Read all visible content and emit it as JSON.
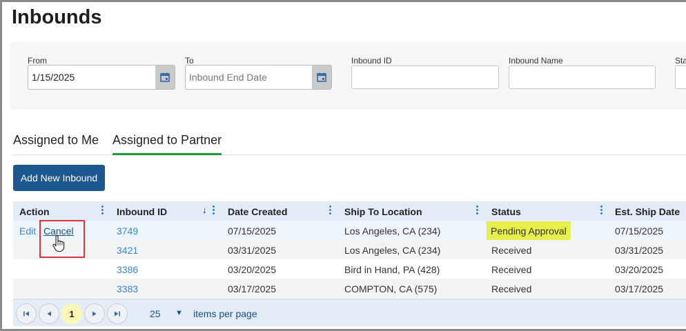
{
  "page": {
    "title": "Inbounds"
  },
  "filters": {
    "from": {
      "label": "From",
      "value": "1/15/2025"
    },
    "to": {
      "label": "To",
      "value": "",
      "placeholder": "Inbound End Date"
    },
    "inbound_id": {
      "label": "Inbound ID",
      "value": ""
    },
    "inbound_name": {
      "label": "Inbound Name",
      "value": ""
    },
    "status": {
      "label": "Sta"
    },
    "calendar_icon": "calendar-icon"
  },
  "tabs": [
    {
      "label": "Assigned to Me",
      "active": false
    },
    {
      "label": "Assigned to Partner",
      "active": true
    }
  ],
  "toolbar": {
    "add_label": "Add New Inbound"
  },
  "grid": {
    "columns": [
      "Action",
      "Inbound ID",
      "Date Created",
      "Ship To Location",
      "Status",
      "Est. Ship Date"
    ],
    "sort_indicator": "↓",
    "action_labels": {
      "edit": "Edit",
      "cancel": "Cancel"
    },
    "rows": [
      {
        "inbound_id": "3749",
        "date_created": "07/15/2025",
        "ship_to": "Los Angeles, CA (234)",
        "status": "Pending Approval",
        "est_ship": "07/15/2025"
      },
      {
        "inbound_id": "3421",
        "date_created": "03/31/2025",
        "ship_to": "Los Angeles, CA (234)",
        "status": "Received",
        "est_ship": "03/31/2025"
      },
      {
        "inbound_id": "3386",
        "date_created": "03/20/2025",
        "ship_to": "Bird in Hand, PA (428)",
        "status": "Received",
        "est_ship": "03/20/2025"
      },
      {
        "inbound_id": "3383",
        "date_created": "03/17/2025",
        "ship_to": "COMPTON, CA (575)",
        "status": "Received",
        "est_ship": "03/17/2025"
      }
    ]
  },
  "pager": {
    "current_page": "1",
    "per_page": "25",
    "per_page_label": "items per page"
  },
  "colors": {
    "accent": "#1c5790",
    "tab_active": "#1a9a36",
    "highlight": "#e6ef4c",
    "annotation": "#d9363e",
    "link": "#3a86c8"
  }
}
